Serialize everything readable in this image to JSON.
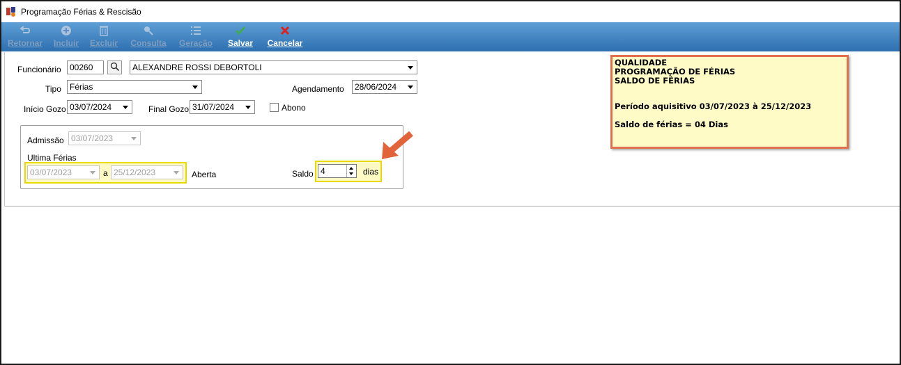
{
  "window": {
    "title": "Programação Férias & Rescisão"
  },
  "toolbar": {
    "buttons": [
      {
        "label": "Retornar",
        "icon": "return-icon",
        "enabled": false
      },
      {
        "label": "Incluir",
        "icon": "plus-circle-icon",
        "enabled": false
      },
      {
        "label": "Excluir",
        "icon": "trash-icon",
        "enabled": false
      },
      {
        "label": "Consulta",
        "icon": "search-icon",
        "enabled": false
      },
      {
        "label": "Geração",
        "icon": "list-icon",
        "enabled": false
      },
      {
        "label": "Salvar",
        "icon": "checkmark-icon",
        "enabled": true,
        "color": "#3cb043"
      },
      {
        "label": "Cancelar",
        "icon": "x-icon",
        "enabled": true,
        "color": "#e02020"
      }
    ]
  },
  "form": {
    "funcionario_label": "Funcionário",
    "funcionario_code": "00260",
    "funcionario_name": "ALEXANDRE ROSSI DEBORTOLI",
    "tipo_label": "Tipo",
    "tipo_value": "Férias",
    "agendamento_label": "Agendamento",
    "agendamento_value": "28/06/2024",
    "inicio_label": "Início Gozo",
    "inicio_value": "03/07/2024",
    "final_label": "Final Gozo",
    "final_value": "31/07/2024",
    "abono_label": "Abono",
    "abono_checked": false
  },
  "group": {
    "admissao_label": "Admissão",
    "admissao_value": "03/07/2023",
    "ultima_label": "Ultima Férias",
    "ultima_from": "03/07/2023",
    "ultima_sep": "a",
    "ultima_to": "25/12/2023",
    "aberta_label": "Aberta",
    "saldo_label": "Saldo",
    "saldo_value": "4",
    "dias_label": "dias"
  },
  "note": {
    "line1": "QUALIDADE",
    "line2": "PROGRAMAÇÃO DE FÉRIAS",
    "line3": "SALDO DE FÉRIAS",
    "line4": "Período aquisitivo 03/07/2023 à 25/12/2023",
    "line5": "Saldo de férias = 04 Dias"
  },
  "colors": {
    "toolbar_top": "#5f9fd6",
    "toolbar_bottom": "#2d6fb0",
    "highlight_border": "#e8d900",
    "highlight_fill": "#fff9c4",
    "note_border": "#e07050",
    "note_fill": "#fefbc7",
    "arrow": "#e2643a"
  }
}
